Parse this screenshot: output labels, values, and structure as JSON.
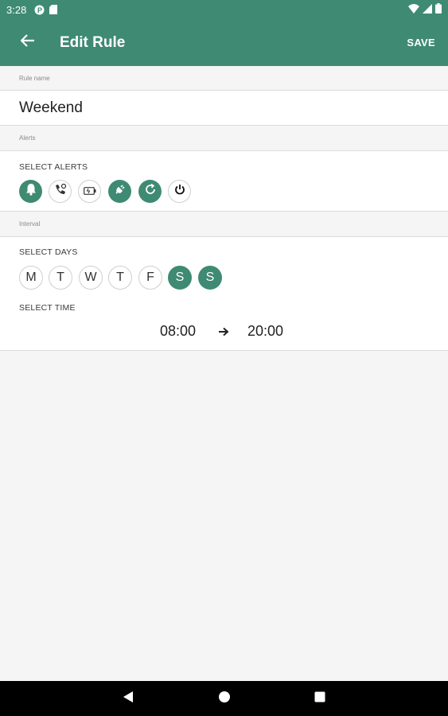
{
  "status_bar": {
    "time": "3:28",
    "icons": [
      "notification-p-icon",
      "sd-card-icon",
      "wifi-icon",
      "signal-icon",
      "battery-icon"
    ]
  },
  "app_bar": {
    "title": "Edit Rule",
    "save_label": "SAVE",
    "back_icon": "arrow-back-icon"
  },
  "rule_name": {
    "header": "Rule name",
    "value": "Weekend"
  },
  "alerts": {
    "header": "Alerts",
    "label": "SELECT ALERTS",
    "items": [
      {
        "icon": "bell-icon",
        "selected": true
      },
      {
        "icon": "phone-call-icon",
        "selected": false
      },
      {
        "icon": "battery-low-icon",
        "selected": false
      },
      {
        "icon": "plug-icon",
        "selected": true
      },
      {
        "icon": "reload-icon",
        "selected": true
      },
      {
        "icon": "power-icon",
        "selected": false
      }
    ]
  },
  "interval": {
    "header": "Interval",
    "days_label": "SELECT DAYS",
    "days": [
      {
        "letter": "M",
        "selected": false
      },
      {
        "letter": "T",
        "selected": false
      },
      {
        "letter": "W",
        "selected": false
      },
      {
        "letter": "T",
        "selected": false
      },
      {
        "letter": "F",
        "selected": false
      },
      {
        "letter": "S",
        "selected": true
      },
      {
        "letter": "S",
        "selected": true
      }
    ],
    "time_label": "SELECT TIME",
    "start_time": "08:00",
    "end_time": "20:00"
  },
  "colors": {
    "accent": "#3f8a72",
    "background": "#f5f5f5"
  }
}
